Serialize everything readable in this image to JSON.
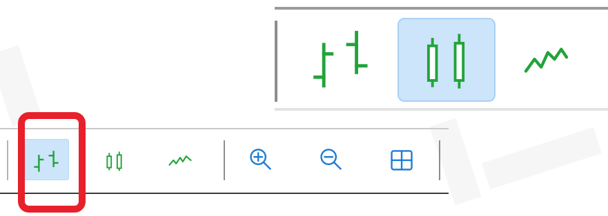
{
  "colors": {
    "accent_green": "#22a33a",
    "zoom_blue": "#1e7dd3",
    "active_bg": "#cce5fb",
    "highlight_red": "#e8202b"
  },
  "toolbar": {
    "buttons": [
      {
        "icon": "bar-chart-icon",
        "state": "active"
      },
      {
        "icon": "candlestick-chart-icon",
        "state": "normal"
      },
      {
        "icon": "line-chart-icon",
        "state": "normal"
      },
      {
        "icon": "zoom-in-icon",
        "state": "normal"
      },
      {
        "icon": "zoom-out-icon",
        "state": "normal"
      },
      {
        "icon": "grid-icon",
        "state": "normal"
      }
    ]
  },
  "zoomed_inset": {
    "buttons": [
      {
        "icon": "bar-chart-icon",
        "state": "normal"
      },
      {
        "icon": "candlestick-chart-icon",
        "state": "active"
      },
      {
        "icon": "line-chart-icon",
        "state": "normal"
      }
    ]
  },
  "annotation": {
    "highlighted_button": "bar-chart-icon"
  }
}
